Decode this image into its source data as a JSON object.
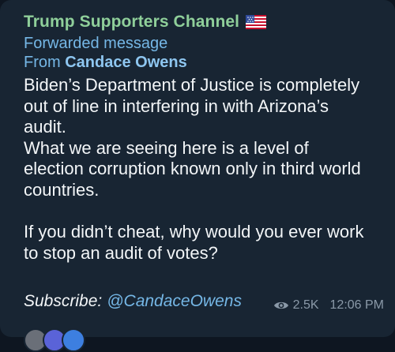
{
  "message": {
    "channel_name": "Trump Supporters Channel",
    "flag_icon": "us-flag-icon",
    "forwarded_label": "Forwarded message",
    "from_prefix": "From ",
    "from_name": "Candace Owens",
    "body": "Biden’s Department of Justice is completely\nout of line in interfering in with Arizona’s\naudit.\nWhat we are seeing here is a level of\nelection corruption known only in third world\ncountries.\n\nIf you didn’t cheat, why would you ever work\nto stop an audit of votes?",
    "subscribe_label": "Subscribe:",
    "subscribe_handle": "@CandaceOwens",
    "views_icon": "eye-icon",
    "views": "2.5K",
    "time": "12:06 PM"
  },
  "colors": {
    "bubble_bg": "#182533",
    "channel_name": "#8fcf9a",
    "link": "#75b7e6",
    "meta": "#8a99a8"
  }
}
